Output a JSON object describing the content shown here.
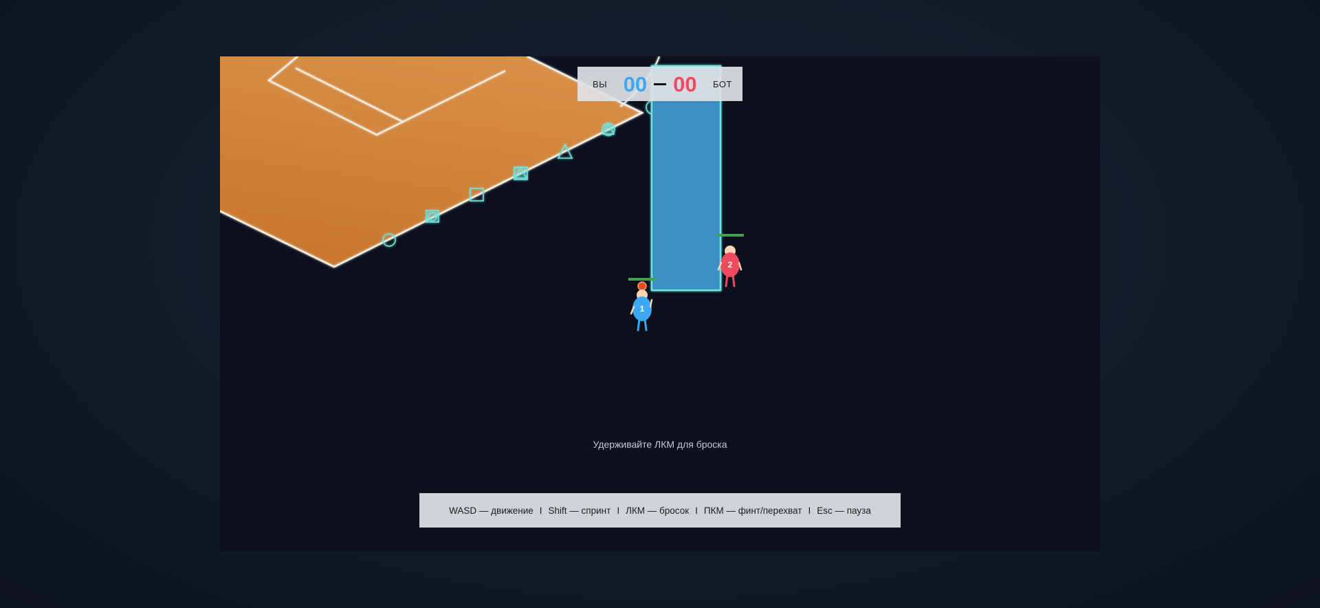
{
  "scoreboard": {
    "you_label": "ВЫ",
    "you_score": "00",
    "bot_label": "БОТ",
    "bot_score": "00",
    "you_color": "#3aa8f5",
    "bot_color": "#ef4b5e"
  },
  "hint": "Удерживайте ЛКМ для броска",
  "controls": [
    "WASD — движение",
    "Shift — спринт",
    "ЛКМ — бросок",
    "ПКМ — финт/перехват",
    "Esc — пауза"
  ],
  "controls_separator": "I",
  "players": [
    {
      "number": "1",
      "team": "you",
      "color": "#3aa8f5",
      "has_ball": true
    },
    {
      "number": "2",
      "team": "bot",
      "color": "#ef4b5e",
      "has_ball": false
    }
  ],
  "court": {
    "floor_color": "#d4873e",
    "line_color": "#f3f1e8",
    "goal_color": "#3d8fc4",
    "goal_outline": "#6fe3de",
    "marker_color": "#6fe3de",
    "markers": [
      "circle",
      "square",
      "square",
      "triangle",
      "triangle",
      "circle",
      "circle"
    ]
  }
}
